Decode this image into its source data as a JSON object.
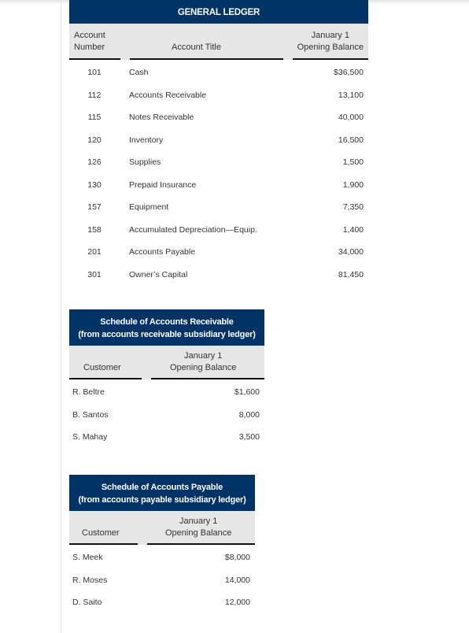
{
  "general_ledger": {
    "title": "GENERAL LEDGER",
    "headers": {
      "account_number_line1": "Account",
      "account_number_line2": "Number",
      "account_title": "Account Title",
      "balance_line1": "January 1",
      "balance_line2": "Opening Balance"
    },
    "rows": [
      {
        "number": "101",
        "title": "Cash",
        "balance": "$36,500"
      },
      {
        "number": "112",
        "title": "Accounts Receivable",
        "balance": "13,100"
      },
      {
        "number": "115",
        "title": "Notes Receivable",
        "balance": "40,000"
      },
      {
        "number": "120",
        "title": "Inventory",
        "balance": "16,500"
      },
      {
        "number": "126",
        "title": "Supplies",
        "balance": "1,500"
      },
      {
        "number": "130",
        "title": "Prepaid Insurance",
        "balance": "1,900"
      },
      {
        "number": "157",
        "title": "Equipment",
        "balance": "7,350"
      },
      {
        "number": "158",
        "title": "Accumulated Depreciation—Equip.",
        "balance": "1,400"
      },
      {
        "number": "201",
        "title": "Accounts Payable",
        "balance": "34,000"
      },
      {
        "number": "301",
        "title": "Owner’s Capital",
        "balance": "81,450"
      }
    ]
  },
  "accounts_receivable_schedule": {
    "title_line1": "Schedule of Accounts Receivable",
    "title_line2": "(from accounts receivable subsidiary ledger)",
    "headers": {
      "customer": "Customer",
      "balance_line1": "January 1",
      "balance_line2": "Opening Balance"
    },
    "rows": [
      {
        "customer": "R. Beltre",
        "balance": "$1,600"
      },
      {
        "customer": "B. Santos",
        "balance": "8,000"
      },
      {
        "customer": "S. Mahay",
        "balance": "3,500"
      }
    ]
  },
  "accounts_payable_schedule": {
    "title_line1": "Schedule of Accounts Payable",
    "title_line2": "(from accounts payable subsidiary ledger)",
    "headers": {
      "customer": "Customer",
      "balance_line1": "January 1",
      "balance_line2": "Opening Balance"
    },
    "rows": [
      {
        "customer": "S. Meek",
        "balance": "$8,000"
      },
      {
        "customer": "R. Moses",
        "balance": "14,000"
      },
      {
        "customer": "D. Saito",
        "balance": "12,000"
      }
    ]
  },
  "colors": {
    "title_bar": "#003366",
    "header_bg": "#e6e6e6"
  }
}
